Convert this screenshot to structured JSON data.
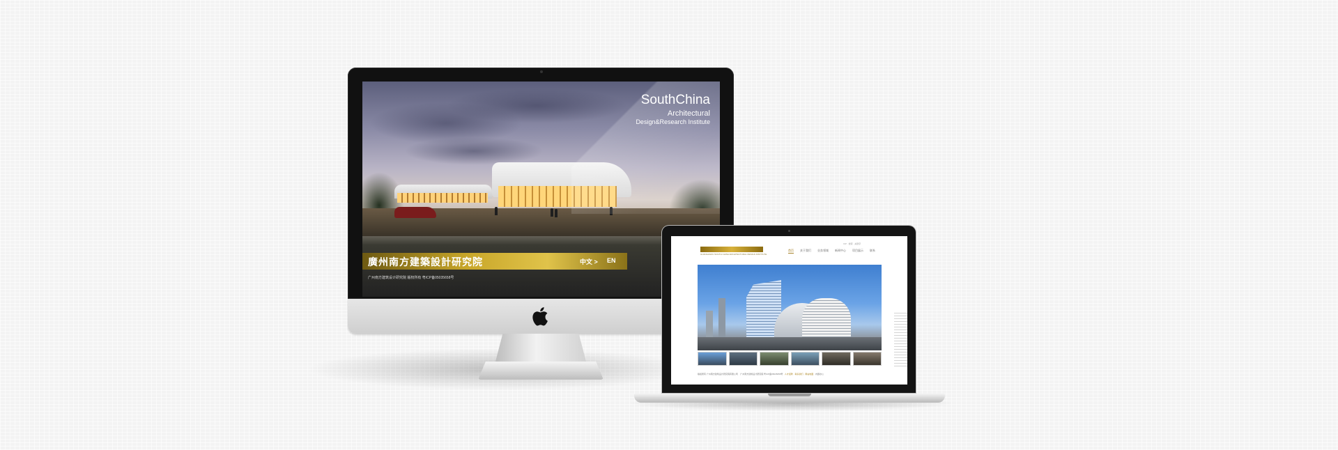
{
  "imac_site": {
    "brand_title": "SouthChina",
    "brand_sub1": "Architectural",
    "brand_sub2": "Design&Research Institute",
    "cn_title": "廣州南方建築設計研究院",
    "nav_cn": "中文 >",
    "nav_en": "EN",
    "footer": "广州南方建筑设计研究院 版权所有 粤ICP备05035658号"
  },
  "laptop_site": {
    "logo_text": "GUANGZHOU SOUTH CHINA ARCHITECTURAL DESIGN INSTITUTE",
    "search": "ICP · 搜索 · 关键字",
    "nav": [
      "首页",
      "关于我们",
      "业务领域",
      "新闻中心",
      "项目展示",
      "联系"
    ],
    "footer_left": "版权所有 广州南方建筑设计研究院有限公司",
    "footer_mid": "广州南方建筑设计研究院 粤ICP备05035658号",
    "footer_links": [
      "人才招聘",
      "联系我们",
      "网站地图",
      "内部办公"
    ]
  },
  "colors": {
    "gold": "#c9a72a",
    "accent_nav": "#a6822a"
  },
  "icons": [
    "apple-logo-icon"
  ]
}
